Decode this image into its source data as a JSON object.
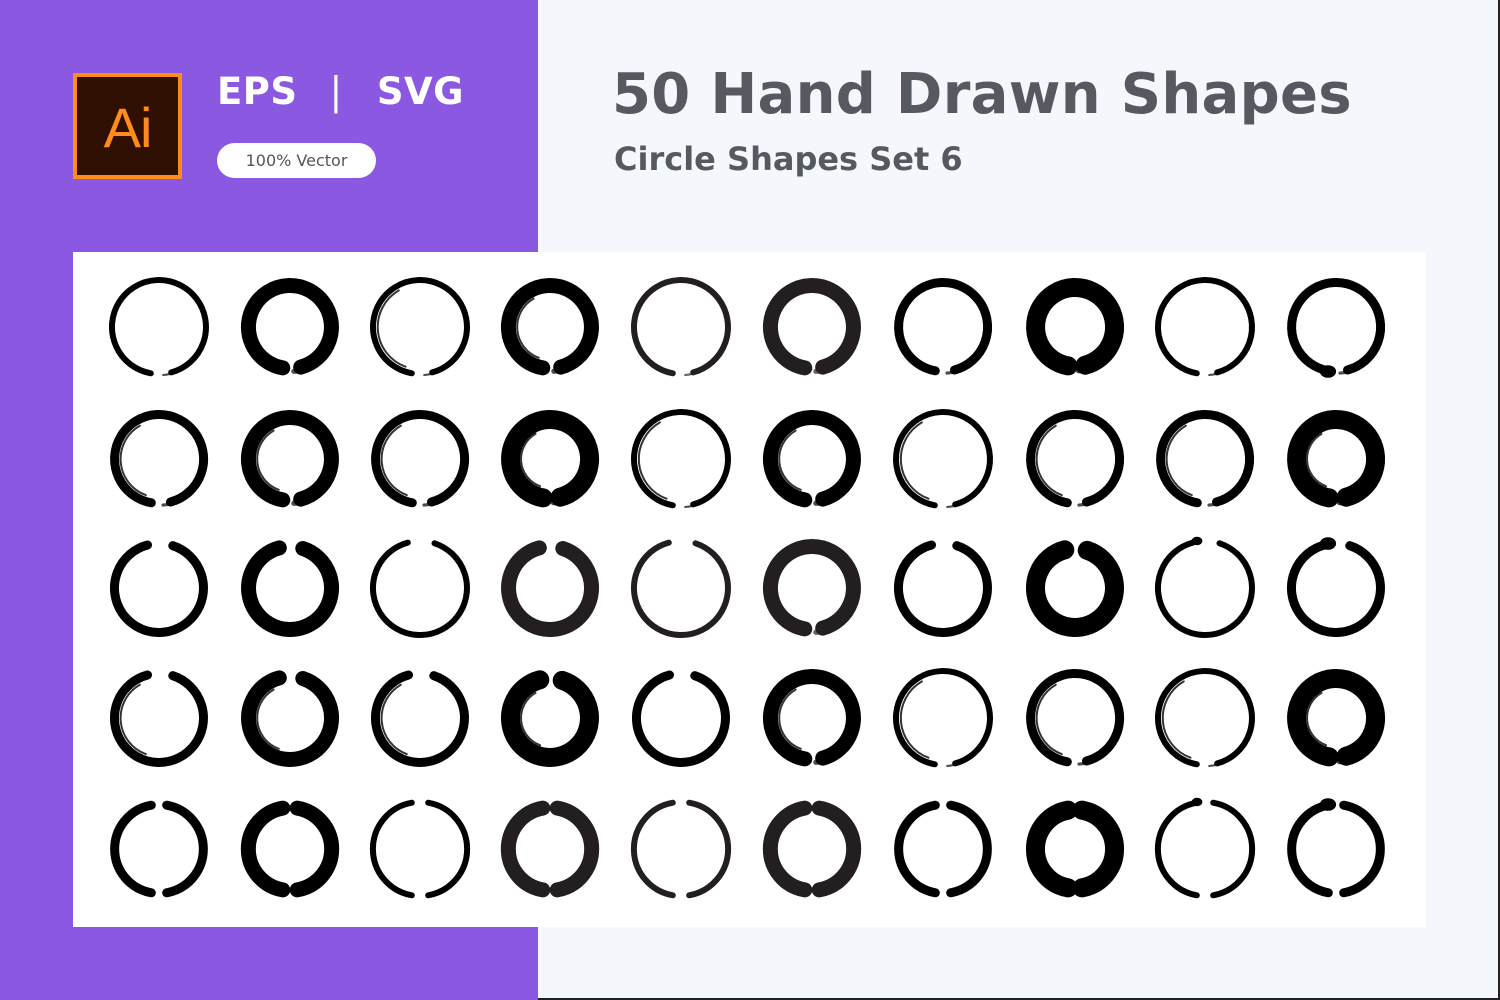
{
  "header": {
    "app_logo_text": "Ai",
    "app_logo_icon": "adobe-illustrator-icon",
    "format_1": "EPS",
    "format_separator": "|",
    "format_2": "SVG",
    "badge": "100% Vector",
    "title": "50 Hand Drawn Shapes",
    "subtitle": "Circle Shapes Set 6"
  },
  "colors": {
    "purple": "#8b58e2",
    "page_bg": "#f4f7fb",
    "panel_bg": "#ffffff",
    "title_text": "#565a60",
    "ai_orange": "#ff8c1a",
    "ai_dark": "#2e0f02",
    "ink": "#000000",
    "ink_soft": "#231f20"
  },
  "shapes_grid": {
    "rows": 5,
    "columns": 10,
    "count": 50,
    "shape_type": "hand-drawn brush circle (enso)",
    "styles": [
      [
        "thin-gap-bottom",
        "thick-gap-bottom",
        "thin-feathered",
        "thick-feathered",
        "thin-soft",
        "thick-rough",
        "medium-gap-bottom",
        "heavy-gap-bottom",
        "thin-dry-right",
        "medium-blob-bottom"
      ],
      [
        "medium-feathered",
        "thick-feathered",
        "medium-streaked",
        "heavy-streaked",
        "thin-feathered",
        "thick-feathered",
        "thin-double",
        "medium-double",
        "medium-streaked",
        "heavy-streaked"
      ],
      [
        "medium-gap-top",
        "thick-gap-top",
        "thin-gap-top",
        "thick-rough-gap-top",
        "thin-soft-gap-top",
        "thick-rough",
        "medium-gap-top",
        "heavy-gap-top",
        "thin-blob-top",
        "medium-blob-top"
      ],
      [
        "medium-feathered-top",
        "thick-feathered-top",
        "medium-feathered-top",
        "heavy-feathered-top",
        "medium-gap-top",
        "thick-feathered",
        "thin-double",
        "medium-double",
        "thin-feathered",
        "heavy-feathered"
      ],
      [
        "medium-split",
        "thick-split",
        "thin-split",
        "thick-rough-split",
        "thin-soft-split",
        "thick-rough-split",
        "medium-split",
        "heavy-split",
        "thin-blob-split",
        "medium-blob-split"
      ]
    ]
  }
}
